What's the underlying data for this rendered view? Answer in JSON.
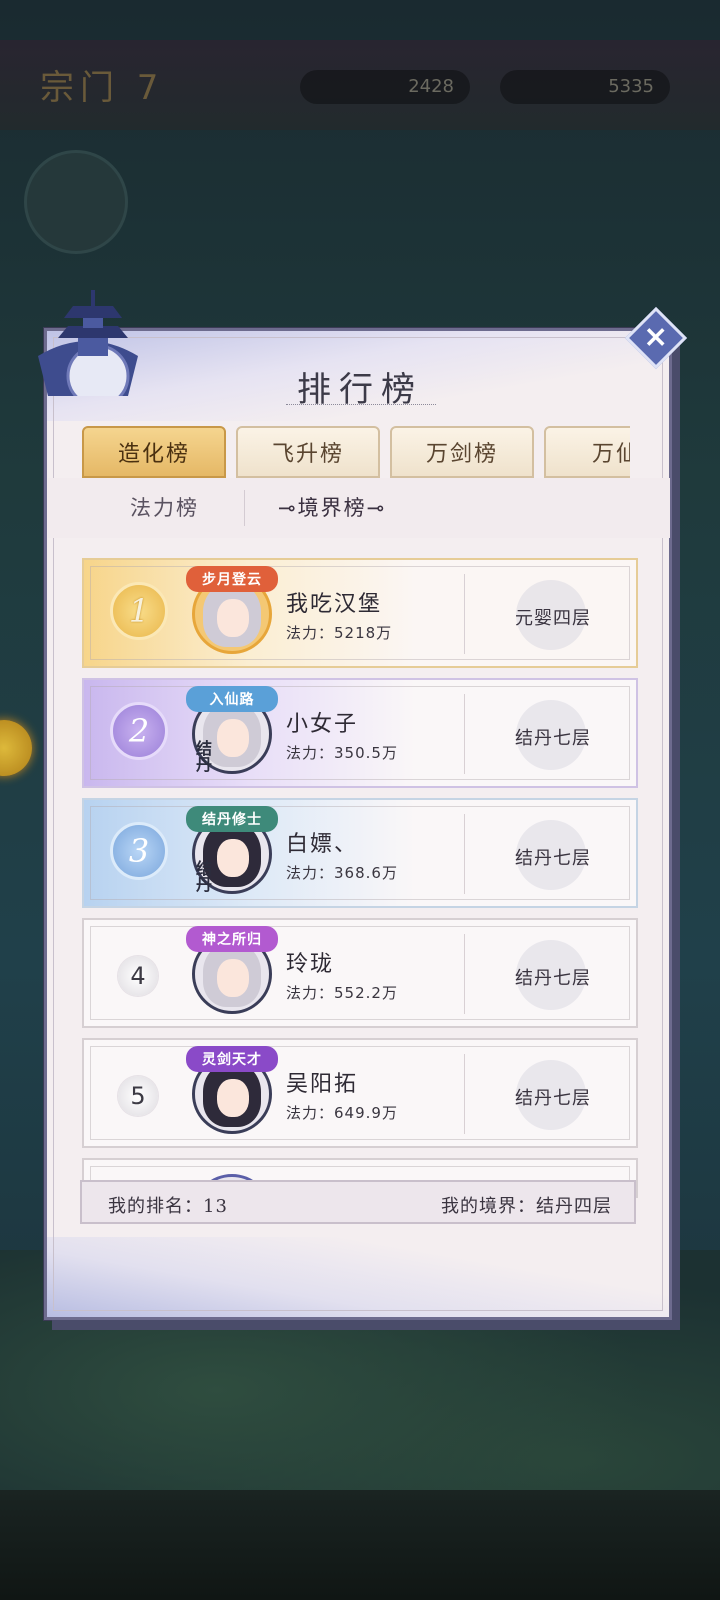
{
  "background": {
    "topbar_title": "宗门 7",
    "res1_value": "2428",
    "res2_value": "5335"
  },
  "panel": {
    "title": "排行榜",
    "close_label": "×"
  },
  "tabs": [
    {
      "label": "造化榜",
      "active": true
    },
    {
      "label": "飞升榜",
      "active": false
    },
    {
      "label": "万剑榜",
      "active": false
    },
    {
      "label": "万仙",
      "active": false
    }
  ],
  "subtabs": [
    {
      "label": "法力榜",
      "active": false
    },
    {
      "label": "⊸境界榜⊸",
      "active": true
    }
  ],
  "rankings": [
    {
      "rank": "1",
      "badge": "步月登云",
      "badge_color": "#e0603a",
      "realm_stamp": "",
      "name": "我吃汉堡",
      "power": "法力：5218万",
      "realm": "元婴四层"
    },
    {
      "rank": "2",
      "badge": "入仙路",
      "badge_color": "#5aa0d8",
      "realm_stamp": "结丹",
      "name": "小女子",
      "power": "法力：350.5万",
      "realm": "结丹七层"
    },
    {
      "rank": "3",
      "badge": "结丹修士",
      "badge_color": "#3e8a7a",
      "realm_stamp": "结丹",
      "name": "白嫖、",
      "power": "法力：368.6万",
      "realm": "结丹七层"
    },
    {
      "rank": "4",
      "badge": "神之所归",
      "badge_color": "#b25ad0",
      "realm_stamp": "",
      "name": "玲珑",
      "power": "法力：552.2万",
      "realm": "结丹七层"
    },
    {
      "rank": "5",
      "badge": "灵剑天才",
      "badge_color": "#8a4ac8",
      "realm_stamp": "",
      "name": "吴阳拓",
      "power": "法力：649.9万",
      "realm": "结丹七层"
    }
  ],
  "footer": {
    "my_rank": "我的排名：13",
    "my_realm": "我的境界：结丹四层"
  },
  "colors": {
    "accent_gold": "#e5b866",
    "panel_bg": "#f4eef0",
    "frame": "#6d6b8e"
  }
}
